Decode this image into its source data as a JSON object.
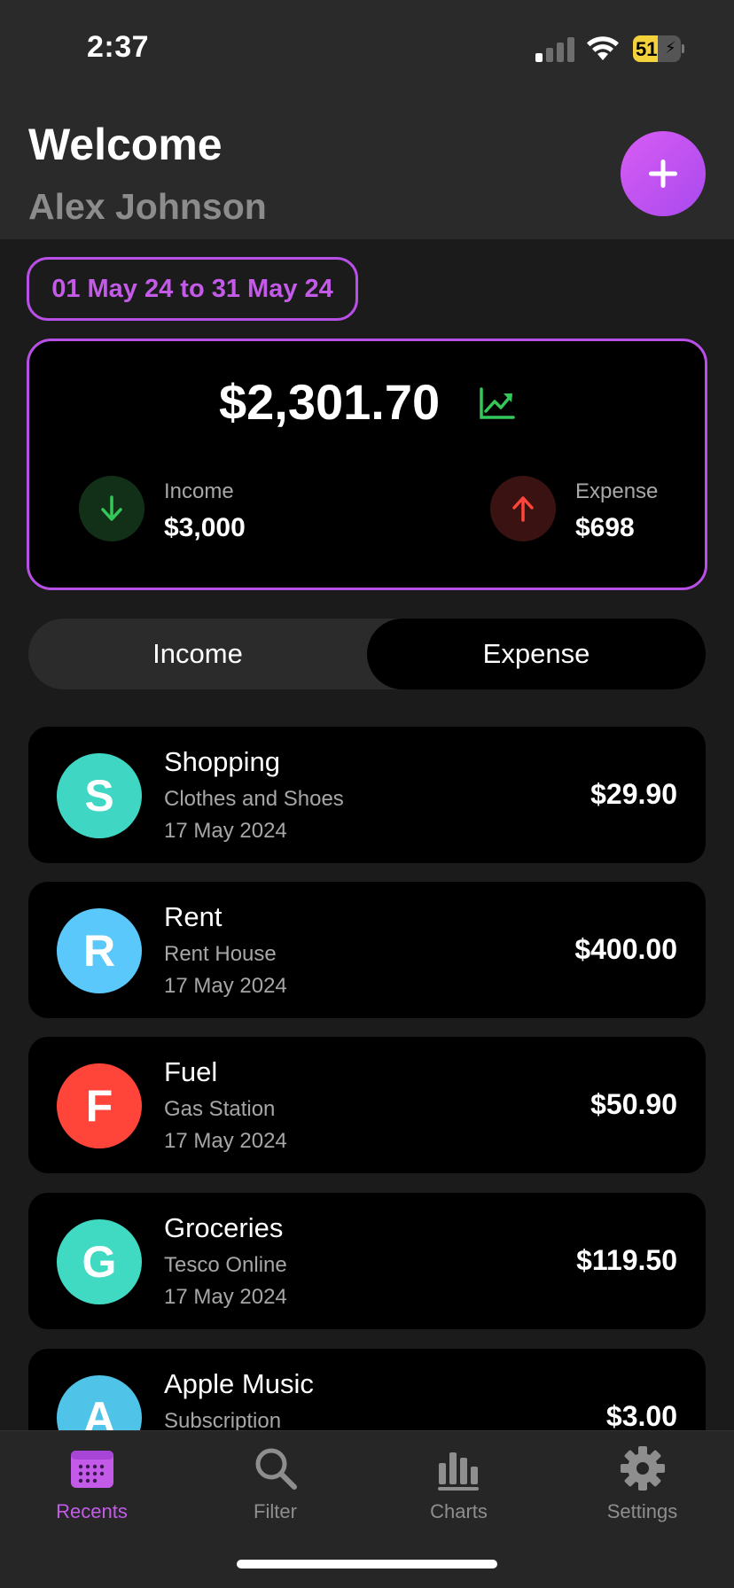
{
  "status_bar": {
    "time": "2:37",
    "battery_percent": "51"
  },
  "header": {
    "welcome": "Welcome",
    "user_name": "Alex Johnson"
  },
  "date_range": "01 May 24 to 31 May 24",
  "summary": {
    "balance": "$2,301.70",
    "income_label": "Income",
    "income_value": "$3,000",
    "expense_label": "Expense",
    "expense_value": "$698"
  },
  "segment": {
    "income": "Income",
    "expense": "Expense",
    "selected": "expense"
  },
  "transactions": [
    {
      "initial": "S",
      "title": "Shopping",
      "subtitle": "Clothes and Shoes",
      "date": "17 May 2024",
      "amount": "$29.90",
      "color": "#3fd6c4"
    },
    {
      "initial": "R",
      "title": "Rent",
      "subtitle": "Rent House",
      "date": "17 May 2024",
      "amount": "$400.00",
      "color": "#5ac8fa"
    },
    {
      "initial": "F",
      "title": "Fuel",
      "subtitle": "Gas Station",
      "date": "17 May 2024",
      "amount": "$50.90",
      "color": "#ff453a"
    },
    {
      "initial": "G",
      "title": "Groceries",
      "subtitle": "Tesco Online",
      "date": "17 May 2024",
      "amount": "$119.50",
      "color": "#40d9c2"
    },
    {
      "initial": "A",
      "title": "Apple Music",
      "subtitle": "Subscription",
      "date": "",
      "amount": "$3.00",
      "color": "#4fc3e8"
    }
  ],
  "tabs": [
    {
      "label": "Recents",
      "icon": "calendar-icon",
      "active": true
    },
    {
      "label": "Filter",
      "icon": "search-icon",
      "active": false
    },
    {
      "label": "Charts",
      "icon": "bar-chart-icon",
      "active": false
    },
    {
      "label": "Settings",
      "icon": "gear-icon",
      "active": false
    }
  ],
  "colors": {
    "accent": "#c35be8",
    "income": "#34c759",
    "expense": "#ff453a"
  }
}
